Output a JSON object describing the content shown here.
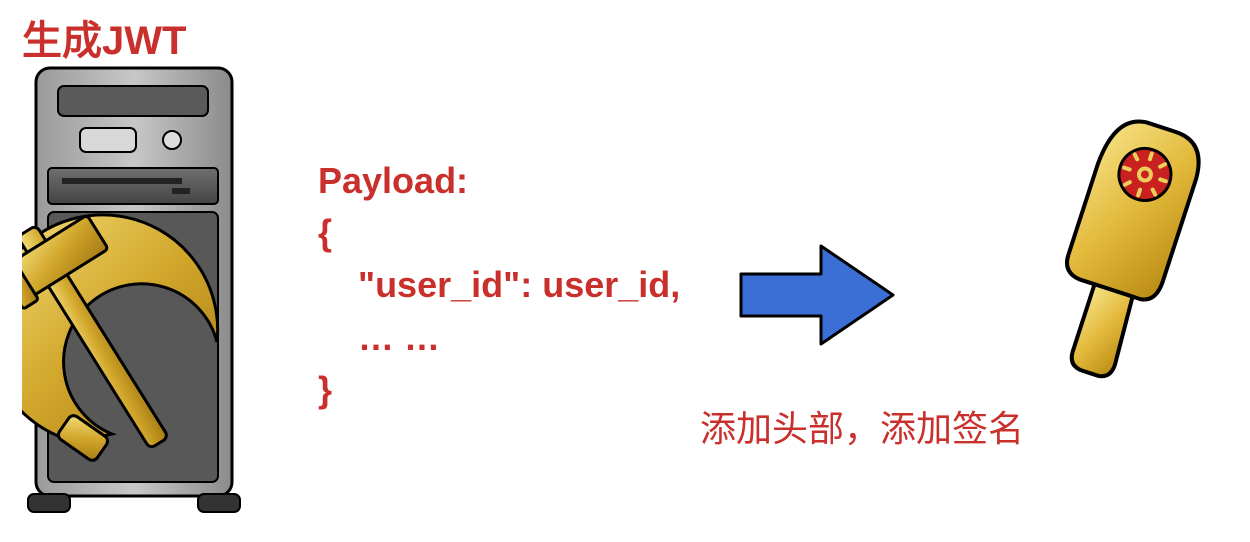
{
  "title": "生成JWT",
  "payload": {
    "label": "Payload:",
    "open": "{",
    "line1_key": "\"user_id\":",
    "line1_val": "user_id,",
    "line2": "… …",
    "close": "}"
  },
  "caption": "添加头部，添加签名",
  "icons": {
    "server": "server-icon",
    "hammer_sickle": "hammer-sickle-icon",
    "arrow": "arrow-right-icon",
    "paddle": "paddle-icon"
  }
}
